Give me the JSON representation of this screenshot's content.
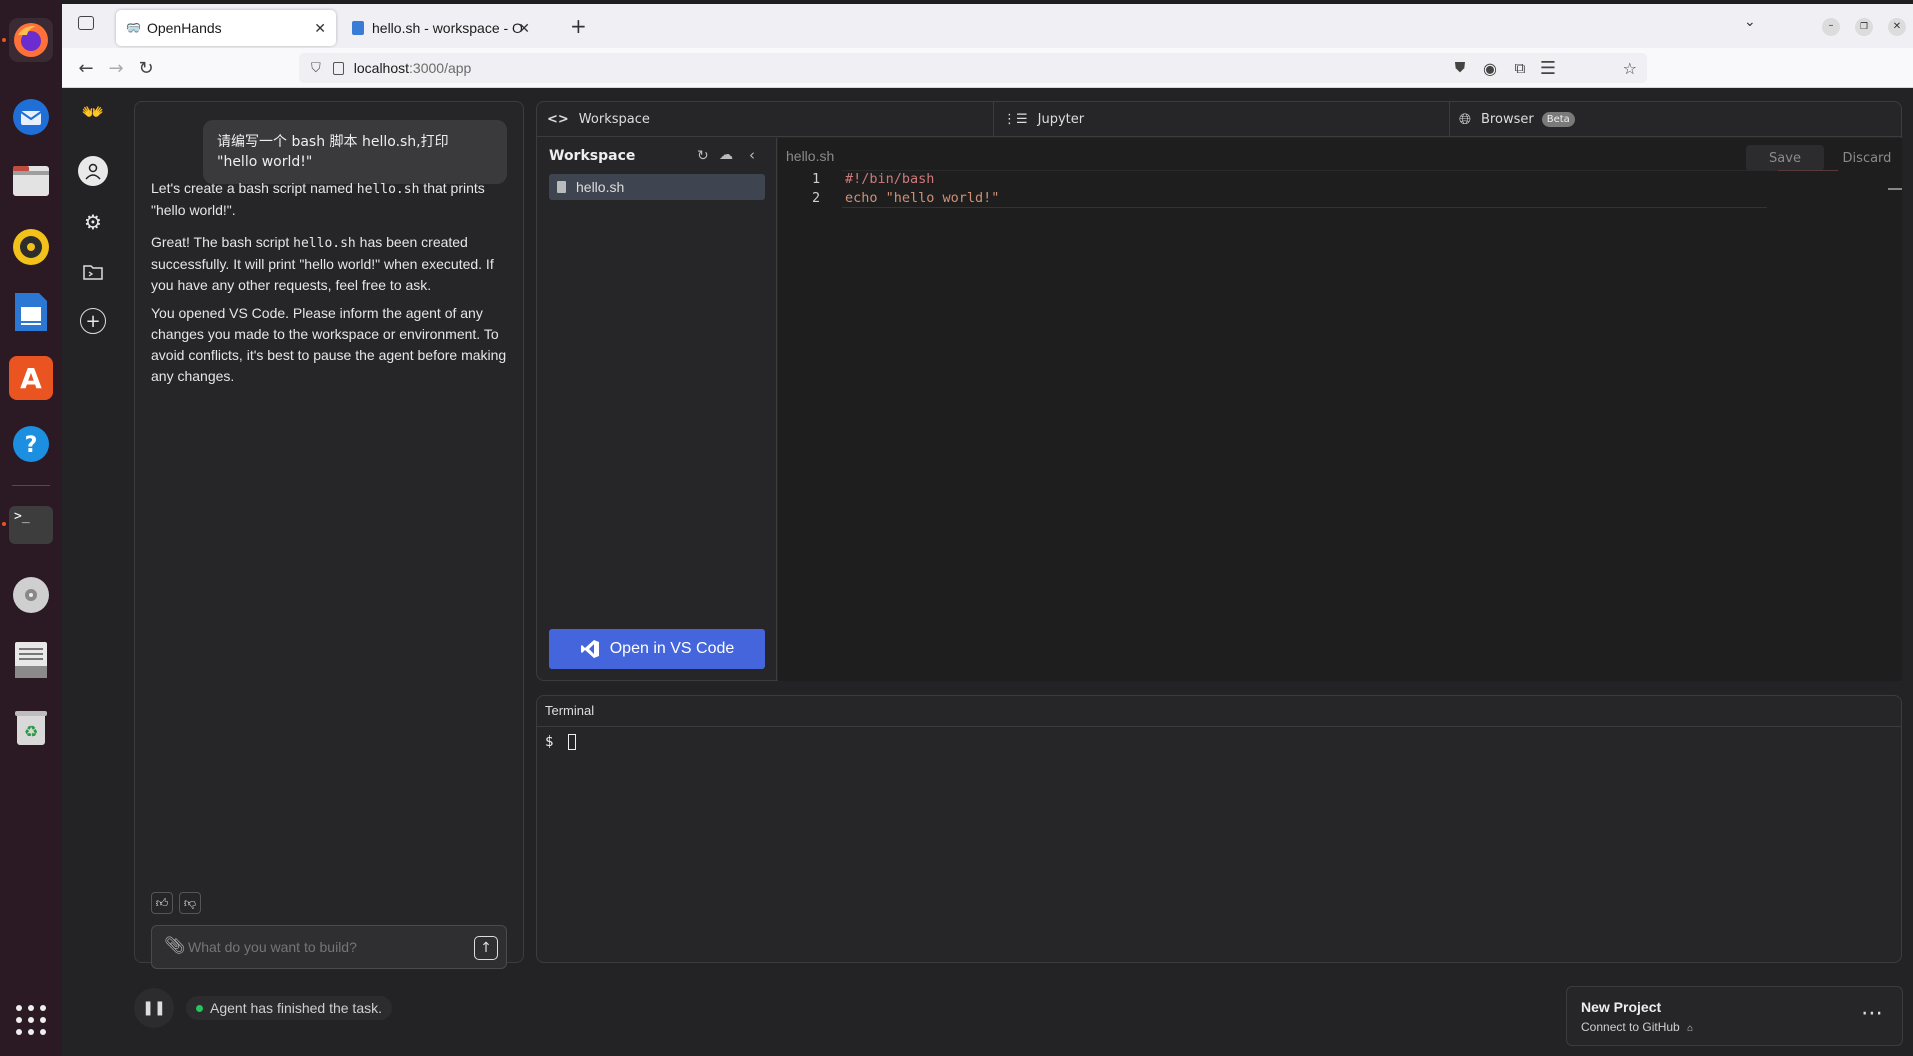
{
  "browser": {
    "tabs": [
      {
        "title": "OpenHands",
        "active": true
      },
      {
        "title": "hello.sh - workspace - Op",
        "active": false
      }
    ],
    "url_host": "localhost",
    "url_path": ":3000/app"
  },
  "chat": {
    "user_message": "请编写一个 bash 脚本 hello.sh,打印 \"hello world!\"",
    "messages": [
      {
        "before": "Let's create a bash script named ",
        "code": "hello.sh",
        "after": " that prints \"hello world!\"."
      },
      {
        "before": "Great! The bash script ",
        "code": "hello.sh",
        "after": " has been created successfully. It will print \"hello world!\" when executed. If you have any other requests, feel free to ask."
      },
      {
        "before": "You opened VS Code. Please inform the agent of any changes you made to the workspace or environment. To avoid conflicts, it's best to pause the agent before making any changes.",
        "code": "",
        "after": ""
      }
    ],
    "input_placeholder": "What do you want to build?"
  },
  "workspace": {
    "tabs": {
      "workspace": "Workspace",
      "jupyter": "Jupyter",
      "browser": "Browser",
      "browser_badge": "Beta"
    },
    "tree_title": "Workspace",
    "files": [
      "hello.sh"
    ],
    "open_vscode": "Open in VS Code",
    "editor": {
      "filename": "hello.sh",
      "save": "Save",
      "discard": "Discard",
      "lines": [
        {
          "num": "1",
          "text": "#!/bin/bash"
        },
        {
          "num": "2",
          "text": "echo \"hello world!\""
        }
      ]
    }
  },
  "terminal": {
    "title": "Terminal",
    "prompt": "$"
  },
  "status": {
    "text": "Agent has finished the task.",
    "color": "#22c55e"
  },
  "project": {
    "title": "New Project",
    "subtitle": "Connect to GitHub"
  },
  "colors": {
    "accent_button": "#4465db",
    "shebang": "#ce7a7a",
    "echo_keyword": "#4ec9b0",
    "string": "#ce9178"
  }
}
